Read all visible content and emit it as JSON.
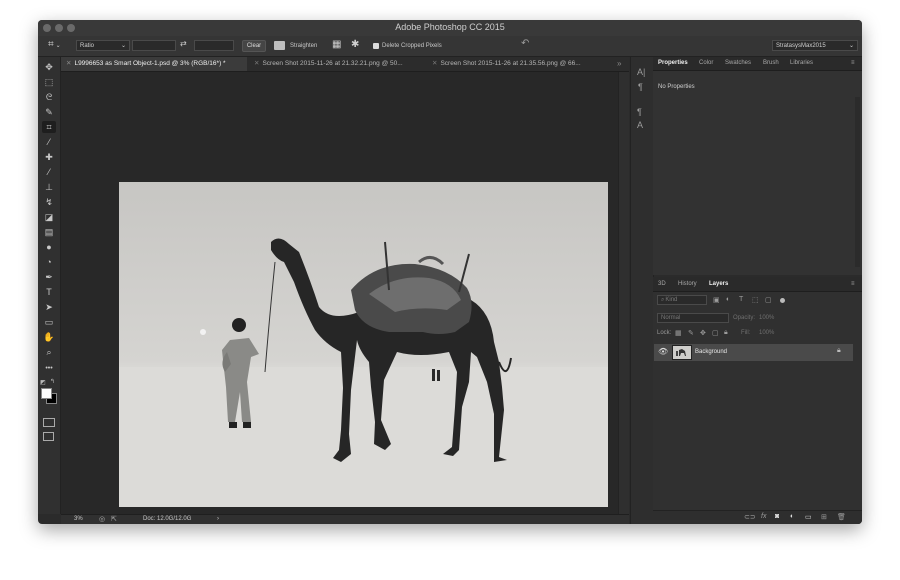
{
  "window": {
    "title": "Adobe Photoshop CC 2015"
  },
  "options_bar": {
    "ratio_select": "Ratio",
    "swap_glyph": "⇄",
    "clear_label": "Clear",
    "straighten_label": "Straighten",
    "delete_cropped_label": "Delete Cropped Pixels",
    "delete_cropped_checked": true,
    "workspace_select": "StratasysMax2015"
  },
  "document_tabs": [
    {
      "label": "L9996653 as Smart Object-1.psd @ 3% (RGB/16*) *",
      "active": true
    },
    {
      "label": "Screen Shot 2015-11-26 at 21.32.21.png @ 50...",
      "active": false
    },
    {
      "label": "Screen Shot 2015-11-26 at 21.35.56.png @ 66...",
      "active": false
    }
  ],
  "tools": [
    {
      "icon": "move-icon",
      "glyph": "✥"
    },
    {
      "icon": "marquee-icon",
      "glyph": "⬚"
    },
    {
      "icon": "lasso-icon",
      "glyph": "ᘓ"
    },
    {
      "icon": "quick-select-icon",
      "glyph": "✎"
    },
    {
      "icon": "crop-icon",
      "glyph": "⌗"
    },
    {
      "icon": "eyedropper-icon",
      "glyph": "⁄"
    },
    {
      "icon": "healing-icon",
      "glyph": "✚"
    },
    {
      "icon": "brush-icon",
      "glyph": "⁄"
    },
    {
      "icon": "stamp-icon",
      "glyph": "⊥"
    },
    {
      "icon": "history-brush-icon",
      "glyph": "↯"
    },
    {
      "icon": "eraser-icon",
      "glyph": "◪"
    },
    {
      "icon": "gradient-icon",
      "glyph": "▤"
    },
    {
      "icon": "blur-icon",
      "glyph": "●"
    },
    {
      "icon": "dodge-icon",
      "glyph": "◔"
    },
    {
      "icon": "pen-icon",
      "glyph": "✒"
    },
    {
      "icon": "type-icon",
      "glyph": "T"
    },
    {
      "icon": "path-select-icon",
      "glyph": "➤"
    },
    {
      "icon": "shape-icon",
      "glyph": "▭"
    },
    {
      "icon": "hand-icon",
      "glyph": "✋"
    },
    {
      "icon": "zoom-icon",
      "glyph": "⌕"
    },
    {
      "icon": "more-tools-icon",
      "glyph": "•••"
    }
  ],
  "properties_panel": {
    "tabs": [
      "Properties",
      "Color",
      "Swatches",
      "Brush",
      "Libraries"
    ],
    "active_tab": "Properties",
    "content": "No Properties"
  },
  "layers_panel": {
    "tabs": [
      "3D",
      "History",
      "Layers"
    ],
    "active_tab": "Layers",
    "filter_kind": "Kind",
    "blend_mode": "Normal",
    "opacity_label": "Opacity:",
    "opacity_value": "100%",
    "lock_label": "Lock:",
    "fill_label": "Fill:",
    "fill_value": "100%",
    "layers": [
      {
        "name": "Background",
        "visible": true,
        "locked": true
      }
    ],
    "footer_icons": [
      "link-icon",
      "fx-icon",
      "mask-icon",
      "adjustment-icon",
      "group-icon",
      "new-layer-icon",
      "trash-icon"
    ]
  },
  "status_bar": {
    "zoom": "3%",
    "doc_info": "Doc: 12.0G/12.0G",
    "arrow": "›"
  },
  "colors": {
    "ui_dark": "#2b2b2b",
    "panel": "#323232",
    "selected_layer": "#4a4a4a"
  }
}
